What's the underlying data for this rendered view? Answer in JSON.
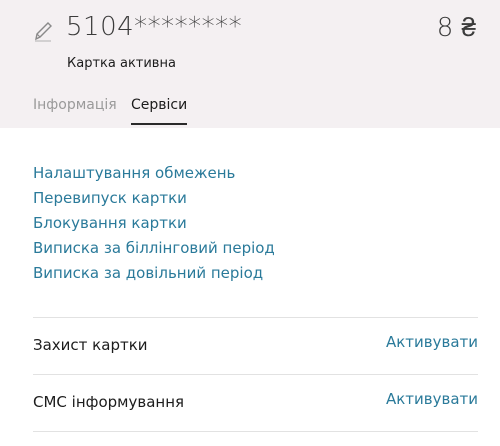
{
  "card": {
    "number": "5104********",
    "balance": "8 ₴",
    "status": "Картка активна"
  },
  "icons": {
    "edit": "pencil-icon"
  },
  "tabs": [
    {
      "label": "Інформація",
      "active": false
    },
    {
      "label": "Сервіси",
      "active": true
    }
  ],
  "services": {
    "links": [
      "Налаштування обмежень",
      "Перевипуск картки",
      "Блокування картки",
      "Виписка за біллінговий період",
      "Виписка за довільний період"
    ],
    "rows": [
      {
        "title": "Захист картки",
        "action": "Активувати"
      },
      {
        "title": "СМС інформування",
        "action": "Активувати"
      }
    ]
  },
  "colors": {
    "header_bg": "#f4f0f2",
    "link": "#2a7a9a",
    "text": "#1c1c1c",
    "muted": "#9a9a9a"
  }
}
